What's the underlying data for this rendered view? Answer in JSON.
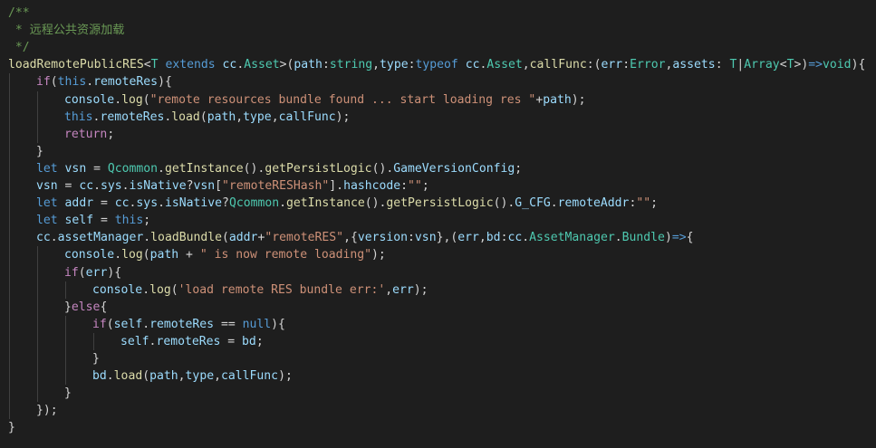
{
  "code": {
    "colors": {
      "background": "#1e1e1e",
      "comment": "#6a9955",
      "function": "#dcdcaa",
      "type": "#4ec9b0",
      "keyword": "#569cd6",
      "control": "#c586c0",
      "variable": "#9cdcfe",
      "string": "#ce9178",
      "default": "#d4d4d4"
    },
    "lines": [
      {
        "indent": 0,
        "tokens": [
          {
            "t": "comment",
            "v": "/**"
          }
        ]
      },
      {
        "indent": 0,
        "tokens": [
          {
            "t": "comment",
            "v": " * 远程公共资源加载"
          }
        ]
      },
      {
        "indent": 0,
        "tokens": [
          {
            "t": "comment",
            "v": " */"
          }
        ]
      },
      {
        "indent": 0,
        "tokens": [
          {
            "t": "function",
            "v": "loadRemotePublicRES"
          },
          {
            "t": "default",
            "v": "<"
          },
          {
            "t": "type",
            "v": "T"
          },
          {
            "t": "default",
            "v": " "
          },
          {
            "t": "keyword",
            "v": "extends"
          },
          {
            "t": "default",
            "v": " "
          },
          {
            "t": "variable",
            "v": "cc"
          },
          {
            "t": "default",
            "v": "."
          },
          {
            "t": "type",
            "v": "Asset"
          },
          {
            "t": "default",
            "v": ">("
          },
          {
            "t": "variable",
            "v": "path"
          },
          {
            "t": "default",
            "v": ":"
          },
          {
            "t": "type",
            "v": "string"
          },
          {
            "t": "default",
            "v": ","
          },
          {
            "t": "variable",
            "v": "type"
          },
          {
            "t": "default",
            "v": ":"
          },
          {
            "t": "keyword",
            "v": "typeof"
          },
          {
            "t": "default",
            "v": " "
          },
          {
            "t": "variable",
            "v": "cc"
          },
          {
            "t": "default",
            "v": "."
          },
          {
            "t": "type",
            "v": "Asset"
          },
          {
            "t": "default",
            "v": ","
          },
          {
            "t": "function",
            "v": "callFunc"
          },
          {
            "t": "default",
            "v": ":("
          },
          {
            "t": "variable",
            "v": "err"
          },
          {
            "t": "default",
            "v": ":"
          },
          {
            "t": "type",
            "v": "Error"
          },
          {
            "t": "default",
            "v": ","
          },
          {
            "t": "variable",
            "v": "assets"
          },
          {
            "t": "default",
            "v": ": "
          },
          {
            "t": "type",
            "v": "T"
          },
          {
            "t": "default",
            "v": "|"
          },
          {
            "t": "type",
            "v": "Array"
          },
          {
            "t": "default",
            "v": "<"
          },
          {
            "t": "type",
            "v": "T"
          },
          {
            "t": "default",
            "v": ">)"
          },
          {
            "t": "keyword",
            "v": "=>"
          },
          {
            "t": "type",
            "v": "void"
          },
          {
            "t": "default",
            "v": "){"
          }
        ]
      },
      {
        "indent": 1,
        "tokens": [
          {
            "t": "control",
            "v": "if"
          },
          {
            "t": "default",
            "v": "("
          },
          {
            "t": "keyword",
            "v": "this"
          },
          {
            "t": "default",
            "v": "."
          },
          {
            "t": "variable",
            "v": "remoteRes"
          },
          {
            "t": "default",
            "v": "){"
          }
        ]
      },
      {
        "indent": 2,
        "tokens": [
          {
            "t": "variable",
            "v": "console"
          },
          {
            "t": "default",
            "v": "."
          },
          {
            "t": "function",
            "v": "log"
          },
          {
            "t": "default",
            "v": "("
          },
          {
            "t": "string",
            "v": "\"remote resources bundle found ... start loading res \""
          },
          {
            "t": "default",
            "v": "+"
          },
          {
            "t": "variable",
            "v": "path"
          },
          {
            "t": "default",
            "v": ");"
          }
        ]
      },
      {
        "indent": 2,
        "tokens": [
          {
            "t": "keyword",
            "v": "this"
          },
          {
            "t": "default",
            "v": "."
          },
          {
            "t": "variable",
            "v": "remoteRes"
          },
          {
            "t": "default",
            "v": "."
          },
          {
            "t": "function",
            "v": "load"
          },
          {
            "t": "default",
            "v": "("
          },
          {
            "t": "variable",
            "v": "path"
          },
          {
            "t": "default",
            "v": ","
          },
          {
            "t": "variable",
            "v": "type"
          },
          {
            "t": "default",
            "v": ","
          },
          {
            "t": "variable",
            "v": "callFunc"
          },
          {
            "t": "default",
            "v": ");"
          }
        ]
      },
      {
        "indent": 2,
        "tokens": [
          {
            "t": "control",
            "v": "return"
          },
          {
            "t": "default",
            "v": ";"
          }
        ]
      },
      {
        "indent": 1,
        "tokens": [
          {
            "t": "default",
            "v": "}"
          }
        ]
      },
      {
        "indent": 1,
        "tokens": [
          {
            "t": "keyword",
            "v": "let"
          },
          {
            "t": "default",
            "v": " "
          },
          {
            "t": "variable",
            "v": "vsn"
          },
          {
            "t": "default",
            "v": " = "
          },
          {
            "t": "type",
            "v": "Qcommon"
          },
          {
            "t": "default",
            "v": "."
          },
          {
            "t": "function",
            "v": "getInstance"
          },
          {
            "t": "default",
            "v": "()."
          },
          {
            "t": "function",
            "v": "getPersistLogic"
          },
          {
            "t": "default",
            "v": "()."
          },
          {
            "t": "variable",
            "v": "GameVersionConfig"
          },
          {
            "t": "default",
            "v": ";"
          }
        ]
      },
      {
        "indent": 1,
        "tokens": [
          {
            "t": "variable",
            "v": "vsn"
          },
          {
            "t": "default",
            "v": " = "
          },
          {
            "t": "variable",
            "v": "cc"
          },
          {
            "t": "default",
            "v": "."
          },
          {
            "t": "variable",
            "v": "sys"
          },
          {
            "t": "default",
            "v": "."
          },
          {
            "t": "variable",
            "v": "isNative"
          },
          {
            "t": "default",
            "v": "?"
          },
          {
            "t": "variable",
            "v": "vsn"
          },
          {
            "t": "default",
            "v": "["
          },
          {
            "t": "string",
            "v": "\"remoteRESHash\""
          },
          {
            "t": "default",
            "v": "]."
          },
          {
            "t": "variable",
            "v": "hashcode"
          },
          {
            "t": "default",
            "v": ":"
          },
          {
            "t": "string",
            "v": "\"\""
          },
          {
            "t": "default",
            "v": ";"
          }
        ]
      },
      {
        "indent": 1,
        "tokens": [
          {
            "t": "keyword",
            "v": "let"
          },
          {
            "t": "default",
            "v": " "
          },
          {
            "t": "variable",
            "v": "addr"
          },
          {
            "t": "default",
            "v": " = "
          },
          {
            "t": "variable",
            "v": "cc"
          },
          {
            "t": "default",
            "v": "."
          },
          {
            "t": "variable",
            "v": "sys"
          },
          {
            "t": "default",
            "v": "."
          },
          {
            "t": "variable",
            "v": "isNative"
          },
          {
            "t": "default",
            "v": "?"
          },
          {
            "t": "type",
            "v": "Qcommon"
          },
          {
            "t": "default",
            "v": "."
          },
          {
            "t": "function",
            "v": "getInstance"
          },
          {
            "t": "default",
            "v": "()."
          },
          {
            "t": "function",
            "v": "getPersistLogic"
          },
          {
            "t": "default",
            "v": "()."
          },
          {
            "t": "variable",
            "v": "G_CFG"
          },
          {
            "t": "default",
            "v": "."
          },
          {
            "t": "variable",
            "v": "remoteAddr"
          },
          {
            "t": "default",
            "v": ":"
          },
          {
            "t": "string",
            "v": "\"\""
          },
          {
            "t": "default",
            "v": ";"
          }
        ]
      },
      {
        "indent": 1,
        "tokens": [
          {
            "t": "keyword",
            "v": "let"
          },
          {
            "t": "default",
            "v": " "
          },
          {
            "t": "variable",
            "v": "self"
          },
          {
            "t": "default",
            "v": " = "
          },
          {
            "t": "keyword",
            "v": "this"
          },
          {
            "t": "default",
            "v": ";"
          }
        ]
      },
      {
        "indent": 1,
        "tokens": [
          {
            "t": "variable",
            "v": "cc"
          },
          {
            "t": "default",
            "v": "."
          },
          {
            "t": "variable",
            "v": "assetManager"
          },
          {
            "t": "default",
            "v": "."
          },
          {
            "t": "function",
            "v": "loadBundle"
          },
          {
            "t": "default",
            "v": "("
          },
          {
            "t": "variable",
            "v": "addr"
          },
          {
            "t": "default",
            "v": "+"
          },
          {
            "t": "string",
            "v": "\"remoteRES\""
          },
          {
            "t": "default",
            "v": ",{"
          },
          {
            "t": "variable",
            "v": "version"
          },
          {
            "t": "default",
            "v": ":"
          },
          {
            "t": "variable",
            "v": "vsn"
          },
          {
            "t": "default",
            "v": "},("
          },
          {
            "t": "variable",
            "v": "err"
          },
          {
            "t": "default",
            "v": ","
          },
          {
            "t": "variable",
            "v": "bd"
          },
          {
            "t": "default",
            "v": ":"
          },
          {
            "t": "variable",
            "v": "cc"
          },
          {
            "t": "default",
            "v": "."
          },
          {
            "t": "type",
            "v": "AssetManager"
          },
          {
            "t": "default",
            "v": "."
          },
          {
            "t": "type",
            "v": "Bundle"
          },
          {
            "t": "default",
            "v": ")"
          },
          {
            "t": "keyword",
            "v": "=>"
          },
          {
            "t": "default",
            "v": "{"
          }
        ]
      },
      {
        "indent": 2,
        "tokens": [
          {
            "t": "variable",
            "v": "console"
          },
          {
            "t": "default",
            "v": "."
          },
          {
            "t": "function",
            "v": "log"
          },
          {
            "t": "default",
            "v": "("
          },
          {
            "t": "variable",
            "v": "path"
          },
          {
            "t": "default",
            "v": " + "
          },
          {
            "t": "string",
            "v": "\" is now remote loading\""
          },
          {
            "t": "default",
            "v": ");"
          }
        ]
      },
      {
        "indent": 2,
        "tokens": [
          {
            "t": "control",
            "v": "if"
          },
          {
            "t": "default",
            "v": "("
          },
          {
            "t": "variable",
            "v": "err"
          },
          {
            "t": "default",
            "v": "){"
          }
        ]
      },
      {
        "indent": 3,
        "tokens": [
          {
            "t": "variable",
            "v": "console"
          },
          {
            "t": "default",
            "v": "."
          },
          {
            "t": "function",
            "v": "log"
          },
          {
            "t": "default",
            "v": "("
          },
          {
            "t": "string",
            "v": "'load remote RES bundle err:'"
          },
          {
            "t": "default",
            "v": ","
          },
          {
            "t": "variable",
            "v": "err"
          },
          {
            "t": "default",
            "v": ");"
          }
        ]
      },
      {
        "indent": 2,
        "tokens": [
          {
            "t": "default",
            "v": "}"
          },
          {
            "t": "control",
            "v": "else"
          },
          {
            "t": "default",
            "v": "{"
          }
        ]
      },
      {
        "indent": 3,
        "tokens": [
          {
            "t": "control",
            "v": "if"
          },
          {
            "t": "default",
            "v": "("
          },
          {
            "t": "variable",
            "v": "self"
          },
          {
            "t": "default",
            "v": "."
          },
          {
            "t": "variable",
            "v": "remoteRes"
          },
          {
            "t": "default",
            "v": " == "
          },
          {
            "t": "keyword",
            "v": "null"
          },
          {
            "t": "default",
            "v": "){"
          }
        ]
      },
      {
        "indent": 4,
        "tokens": [
          {
            "t": "variable",
            "v": "self"
          },
          {
            "t": "default",
            "v": "."
          },
          {
            "t": "variable",
            "v": "remoteRes"
          },
          {
            "t": "default",
            "v": " = "
          },
          {
            "t": "variable",
            "v": "bd"
          },
          {
            "t": "default",
            "v": ";"
          }
        ]
      },
      {
        "indent": 3,
        "tokens": [
          {
            "t": "default",
            "v": "}"
          }
        ]
      },
      {
        "indent": 3,
        "tokens": [
          {
            "t": "variable",
            "v": "bd"
          },
          {
            "t": "default",
            "v": "."
          },
          {
            "t": "function",
            "v": "load"
          },
          {
            "t": "default",
            "v": "("
          },
          {
            "t": "variable",
            "v": "path"
          },
          {
            "t": "default",
            "v": ","
          },
          {
            "t": "variable",
            "v": "type"
          },
          {
            "t": "default",
            "v": ","
          },
          {
            "t": "variable",
            "v": "callFunc"
          },
          {
            "t": "default",
            "v": ");"
          }
        ]
      },
      {
        "indent": 2,
        "tokens": [
          {
            "t": "default",
            "v": "}"
          }
        ]
      },
      {
        "indent": 1,
        "tokens": [
          {
            "t": "default",
            "v": "});"
          }
        ]
      },
      {
        "indent": 0,
        "tokens": [
          {
            "t": "default",
            "v": "}"
          }
        ]
      }
    ]
  }
}
